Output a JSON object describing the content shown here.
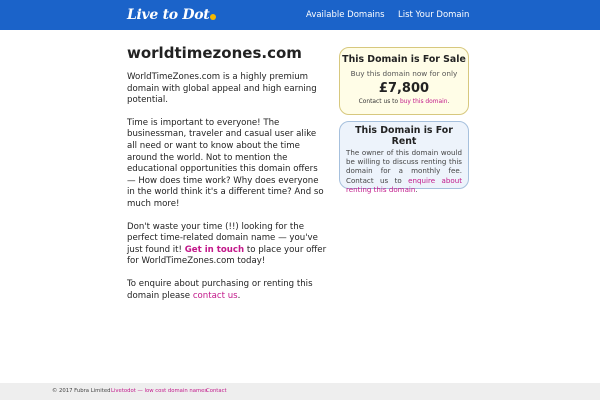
{
  "header": {
    "logo_text": "Live to Dot",
    "nav": [
      "Available Domains",
      "List Your Domain"
    ],
    "colors": {
      "bar": "#1b63c9",
      "logo_dot": "#f6b800"
    }
  },
  "main": {
    "title": "worldtimezones.com",
    "intro": "WorldTimeZones.com is a highly premium domain with global appeal and high earning potential.",
    "para2": "Time is important to everyone! The businessman, traveler and casual user alike all need or want to know about the time around the world. Not to mention the educational opportunities this domain offers — How does time work? Why does everyone in the world think it's a different time? And so much more!",
    "para3_a": "Don't waste your time (!!) looking for the perfect time-related domain name — you've just found it!",
    "para3_link": "Get in touch",
    "para3_b": "to place your offer for WorldTimeZones.com today!",
    "para4_a": "To enquire about purchasing or renting this domain please",
    "para4_link": "contact us",
    "para4_b": "."
  },
  "sale": {
    "title": "This Domain is For Sale",
    "line": "Buy this domain now for only",
    "price": "£7,800",
    "small_a": "Contact us to",
    "small_link": "buy this domain",
    "small_b": "."
  },
  "rent": {
    "title": "This Domain is For Rent",
    "text_a": "The owner of this domain would be willing to discuss renting this domain for a monthly fee. Contact us to",
    "text_link": "enquire about renting this domain",
    "text_b": "."
  },
  "footer": {
    "copyright": "© 2017 Fubra Limited",
    "link1": "Livetodot — low cost domain names",
    "link2": "Contact"
  },
  "colors": {
    "link": "#c2188a",
    "sale_bg": "#fffde7",
    "rent_bg": "#edf3fb",
    "footer_bg": "#eeeeee"
  }
}
